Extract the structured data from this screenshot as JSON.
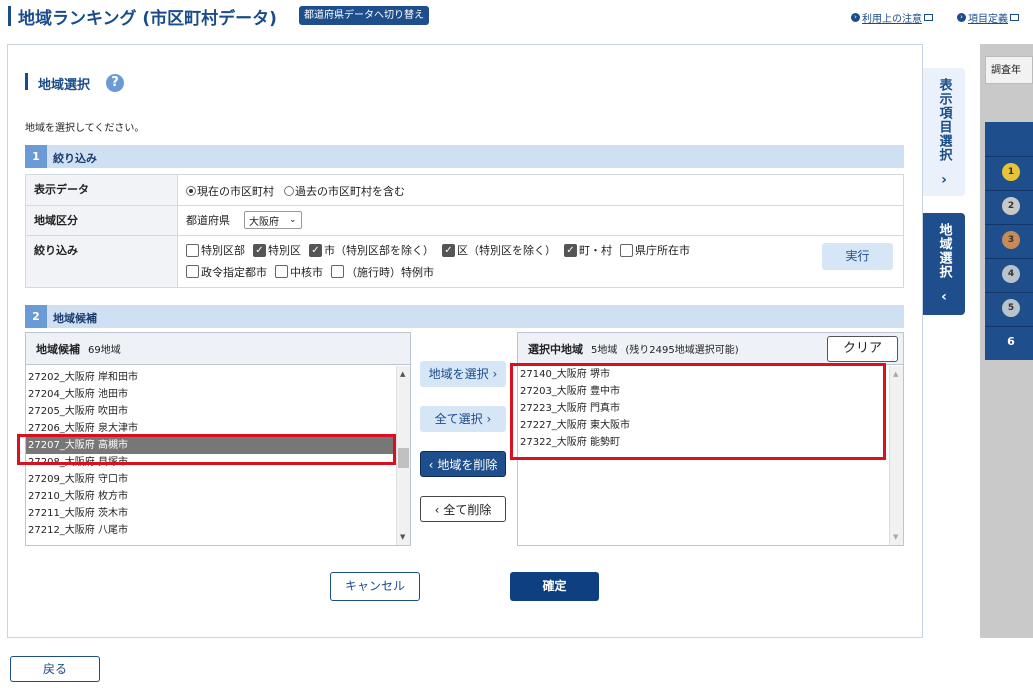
{
  "header": {
    "title": "地域ランキング (市区町村データ)",
    "toggle_label": "都道府県データへ切り替え",
    "links": [
      {
        "label": "利用上の注意"
      },
      {
        "label": "項目定義"
      }
    ]
  },
  "section": {
    "title": "地域選択",
    "help": "?",
    "note": "地域を選択してください。"
  },
  "step1": {
    "num": "1",
    "label": "絞り込み",
    "rows": {
      "display": {
        "label": "表示データ",
        "options": [
          {
            "label": "現在の市区町村",
            "selected": true
          },
          {
            "label": "過去の市区町村を含む",
            "selected": false
          }
        ]
      },
      "region": {
        "label": "地域区分",
        "pref_label": "都道府県",
        "pref_value": "大阪府"
      },
      "filter": {
        "label": "絞り込み",
        "checks": [
          {
            "label": "特別区部",
            "checked": false
          },
          {
            "label": "特別区",
            "checked": true
          },
          {
            "label": "市（特別区部を除く）",
            "checked": true
          },
          {
            "label": "区（特別区を除く）",
            "checked": true
          },
          {
            "label": "町・村",
            "checked": true
          },
          {
            "label": "県庁所在市",
            "checked": false
          },
          {
            "label": "政令指定都市",
            "checked": false
          },
          {
            "label": "中核市",
            "checked": false
          },
          {
            "label": "（施行時）特例市",
            "checked": false
          }
        ],
        "exec_label": "実行"
      }
    }
  },
  "step2": {
    "num": "2",
    "label": "地域候補",
    "candidates": {
      "title": "地域候補",
      "count": "69地域",
      "items": [
        "27202_大阪府 岸和田市",
        "27204_大阪府 池田市",
        "27205_大阪府 吹田市",
        "27206_大阪府 泉大津市",
        "27207_大阪府 高槻市",
        "27208_大阪府 貝塚市",
        "27209_大阪府 守口市",
        "27210_大阪府 枚方市",
        "27211_大阪府 茨木市",
        "27212_大阪府 八尾市"
      ],
      "selected_index": 4
    },
    "buttons": {
      "select": "地域を選択",
      "select_all": "全て選択",
      "remove": "地域を削除",
      "remove_all": "全て削除"
    },
    "selected": {
      "title": "選択中地域",
      "count": "5地域",
      "remaining": "(残り2495地域選択可能)",
      "clear_label": "クリア",
      "items": [
        "27140_大阪府 堺市",
        "27203_大阪府 豊中市",
        "27223_大阪府 門真市",
        "27227_大阪府 東大阪市",
        "27322_大阪府 能勢町"
      ]
    }
  },
  "actions": {
    "cancel": "キャンセル",
    "confirm": "確定",
    "back": "戻る"
  },
  "side_tabs": {
    "items_tab": "表示項目選択",
    "region_tab": "地域選択"
  },
  "right_panel": {
    "head": "調査年",
    "medals": [
      "1",
      "2",
      "3",
      "4",
      "5",
      "6"
    ]
  },
  "colors": {
    "primary": "#1f4e8c",
    "step_header": "#cfe0f3",
    "highlight_red": "#d9101e"
  }
}
